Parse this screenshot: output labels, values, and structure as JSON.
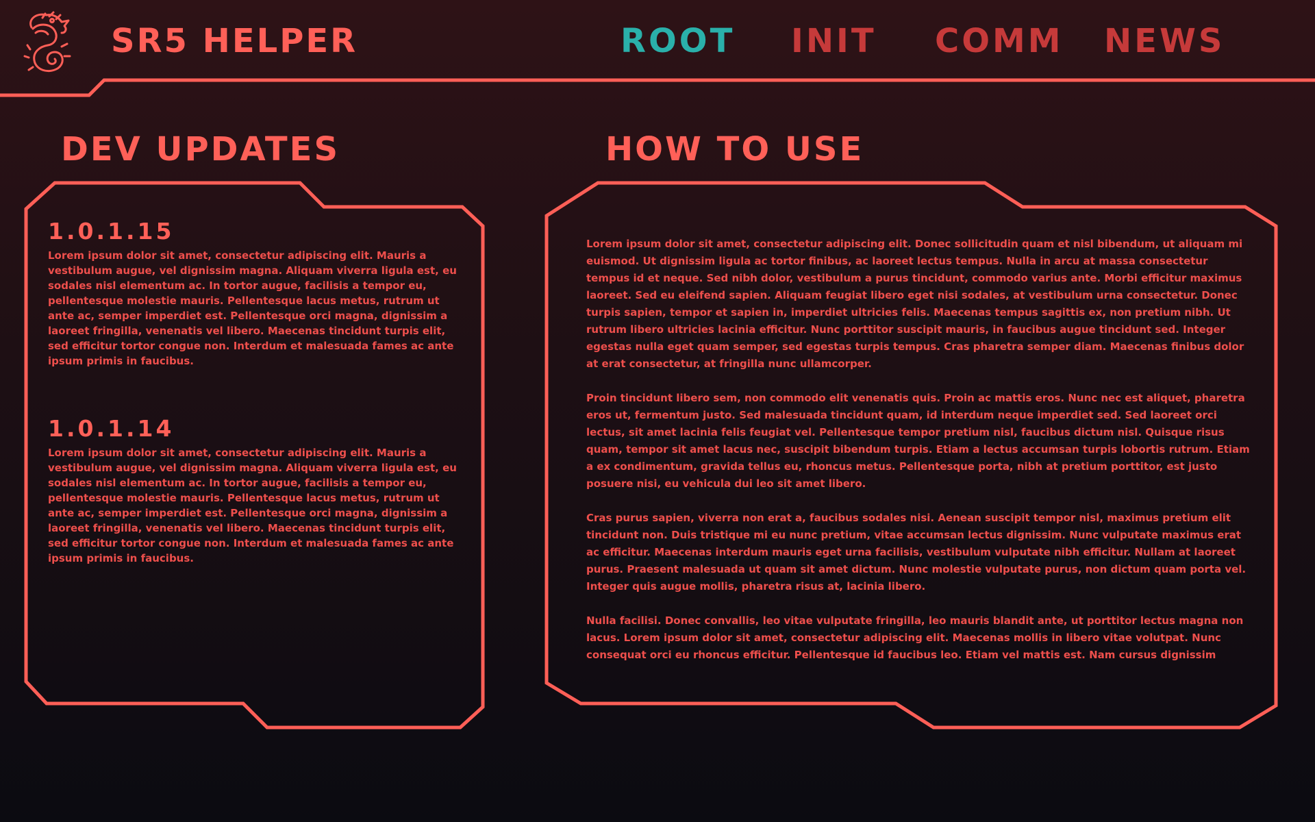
{
  "header": {
    "app_title": "SR5 HELPER",
    "logo_icon": "serpent-dragon-logo-icon",
    "nav": [
      {
        "label": "ROOT",
        "active": true
      },
      {
        "label": "INIT",
        "active": false
      },
      {
        "label": "COMM",
        "active": false
      },
      {
        "label": "NEWS",
        "active": false
      }
    ]
  },
  "dev_updates": {
    "title": "DEV UPDATES",
    "entries": [
      {
        "version": "1.0.1.15",
        "text": "Lorem ipsum dolor sit amet, consectetur adipiscing elit. Mauris a vestibulum augue, vel dignissim magna. Aliquam viverra ligula est, eu sodales nisl elementum ac. In tortor augue, facilisis a tempor eu, pellentesque molestie mauris. Pellentesque lacus metus, rutrum ut ante ac, semper imperdiet est. Pellentesque orci magna, dignissim a laoreet fringilla, venenatis vel libero. Maecenas tincidunt turpis elit, sed efficitur tortor congue non. Interdum et malesuada fames ac ante ipsum primis in faucibus."
      },
      {
        "version": "1.0.1.14",
        "text": "Lorem ipsum dolor sit amet, consectetur adipiscing elit. Mauris a vestibulum augue, vel dignissim magna. Aliquam viverra ligula est, eu sodales nisl elementum ac. In tortor augue, facilisis a tempor eu, pellentesque molestie mauris. Pellentesque lacus metus, rutrum ut ante ac, semper imperdiet est. Pellentesque orci magna, dignissim a laoreet fringilla, venenatis vel libero. Maecenas tincidunt turpis elit, sed efficitur tortor congue non. Interdum et malesuada fames ac ante ipsum primis in faucibus."
      }
    ]
  },
  "how_to_use": {
    "title": "HOW TO USE",
    "paragraphs": [
      "Lorem ipsum dolor sit amet, consectetur adipiscing elit. Donec sollicitudin quam et nisl bibendum, ut aliquam mi euismod. Ut dignissim ligula ac tortor finibus, ac laoreet lectus tempus. Nulla in arcu at massa consectetur tempus id et neque. Sed nibh dolor, vestibulum a purus tincidunt, commodo varius ante. Morbi efficitur maximus laoreet. Sed eu eleifend sapien. Aliquam feugiat libero eget nisi sodales, at vestibulum urna consectetur. Donec turpis sapien, tempor et sapien in, imperdiet ultricies felis. Maecenas tempus sagittis ex, non pretium nibh. Ut rutrum libero ultricies lacinia efficitur. Nunc porttitor suscipit mauris, in faucibus augue tincidunt sed. Integer egestas nulla eget quam semper, sed egestas turpis tempus. Cras pharetra semper diam. Maecenas finibus dolor at erat consectetur, at fringilla nunc ullamcorper.",
      "Proin tincidunt libero sem, non commodo elit venenatis quis. Proin ac mattis eros. Nunc nec est aliquet, pharetra eros ut, fermentum justo. Sed malesuada tincidunt quam, id interdum neque imperdiet sed. Sed laoreet orci lectus, sit amet lacinia felis feugiat vel. Pellentesque tempor pretium nisl, faucibus dictum nisl. Quisque risus quam, tempor sit amet lacus nec, suscipit bibendum turpis. Etiam a lectus accumsan turpis lobortis rutrum. Etiam a ex condimentum, gravida tellus eu, rhoncus metus. Pellentesque porta, nibh at pretium porttitor, est justo posuere nisi, eu vehicula dui leo sit amet libero.",
      "Cras purus sapien, viverra non erat a, faucibus sodales nisi. Aenean suscipit tempor nisl, maximus pretium elit tincidunt non. Duis tristique mi eu nunc pretium, vitae accumsan lectus dignissim. Nunc vulputate maximus erat ac efficitur. Maecenas interdum mauris eget urna facilisis, vestibulum vulputate nibh efficitur. Nullam at laoreet purus. Praesent malesuada ut quam sit amet dictum. Nunc molestie vulputate purus, non dictum quam porta vel. Integer quis augue mollis, pharetra risus at, lacinia libero.",
      "Nulla facilisi. Donec convallis, leo vitae vulputate fringilla, leo mauris blandit ante, ut porttitor lectus magna non lacus. Lorem ipsum dolor sit amet, consectetur adipiscing elit. Maecenas mollis in libero vitae volutpat. Nunc consequat orci eu rhoncus efficitur. Pellentesque id faucibus leo. Etiam vel mattis est. Nam cursus dignissim"
    ]
  },
  "colors": {
    "accent": "#ff5f57",
    "nav_inactive": "#c63a3a",
    "nav_active": "#2ab0aa",
    "background_top": "#2e1216",
    "background_bottom": "#0b0b11"
  }
}
